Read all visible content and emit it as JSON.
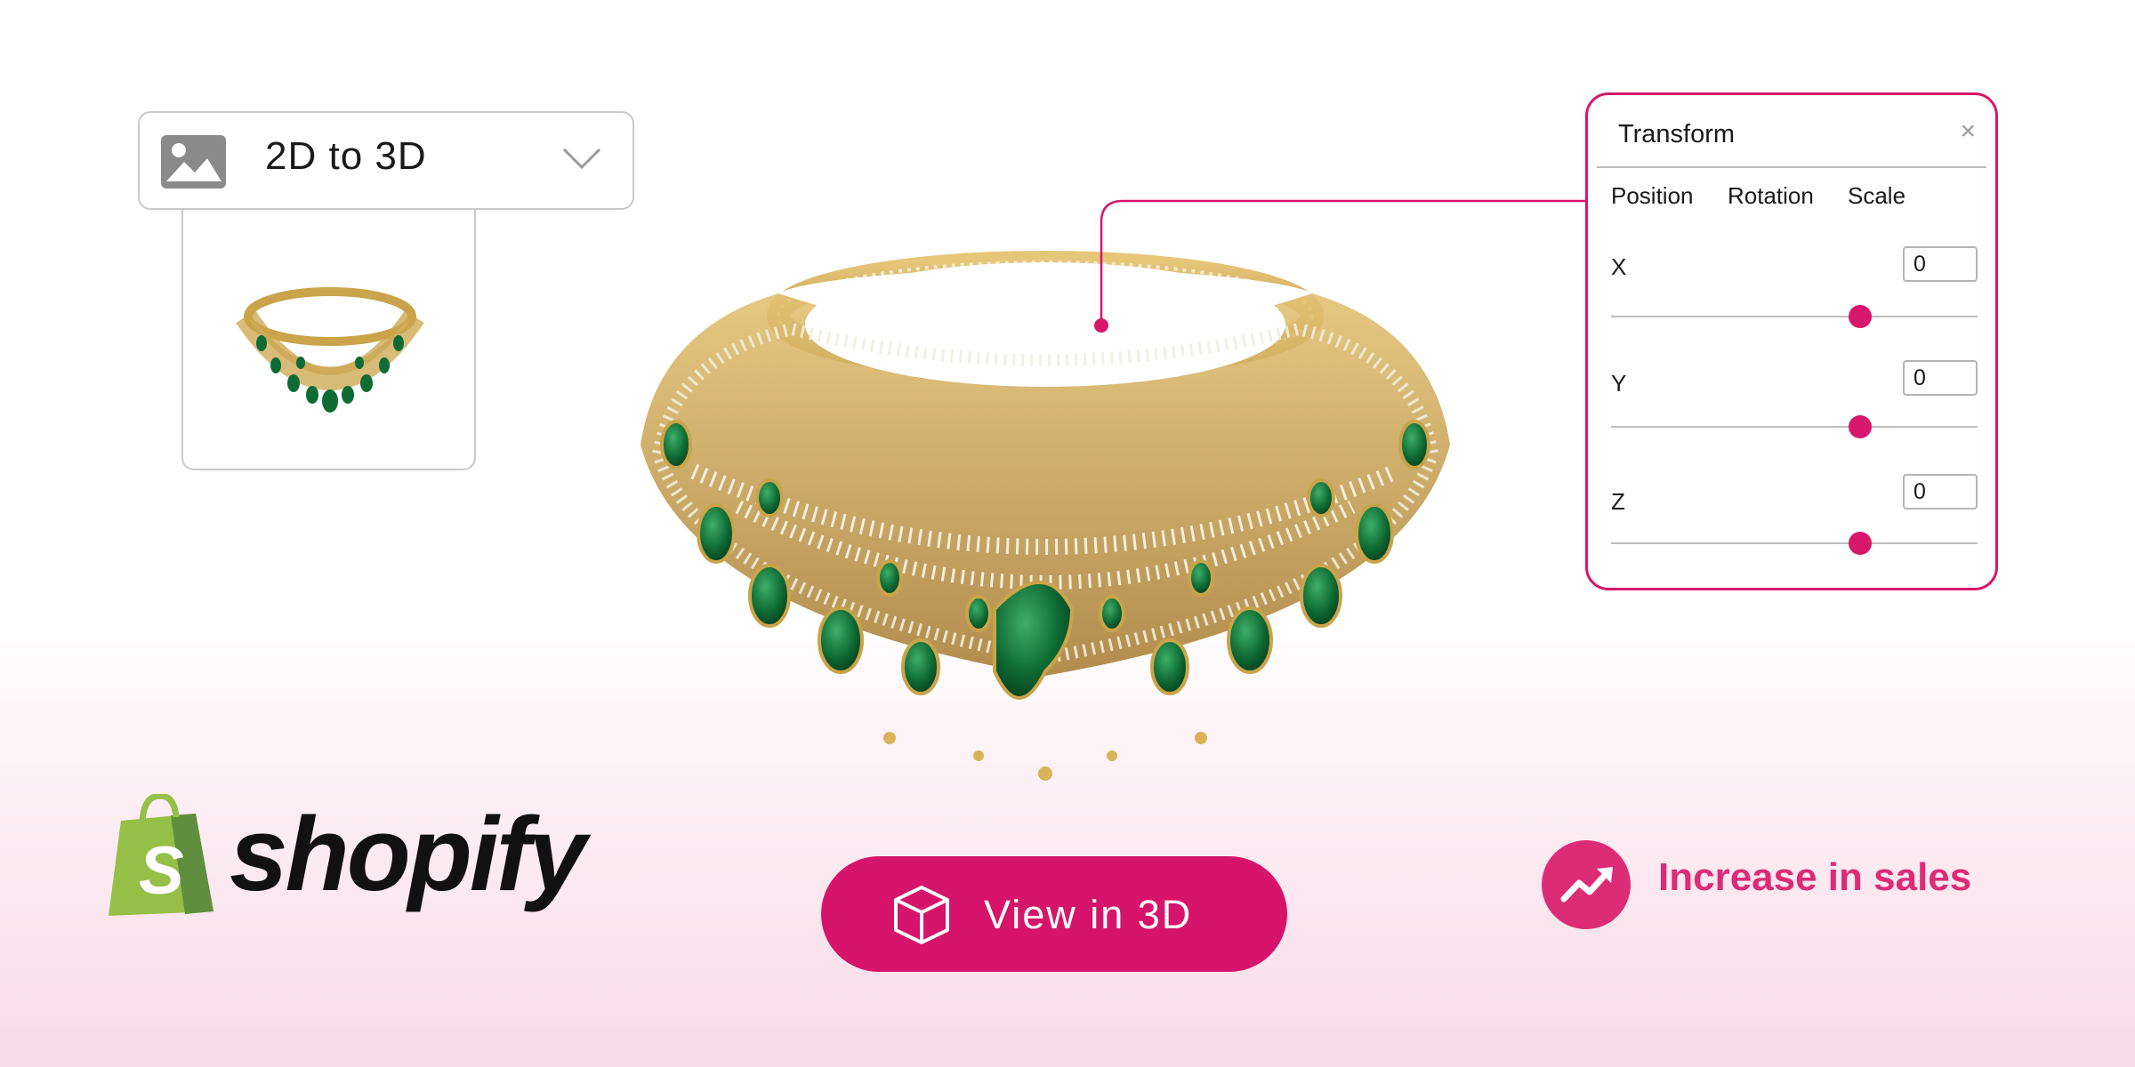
{
  "dropdown": {
    "label": "2D to 3D",
    "icon": "image-icon",
    "chevron": "chevron-down-icon"
  },
  "transform_panel": {
    "title": "Transform",
    "close": "×",
    "tabs": [
      "Position",
      "Rotation",
      "Scale"
    ],
    "axes": [
      {
        "label": "X",
        "value": "0",
        "slider_level": 0.68
      },
      {
        "label": "Y",
        "value": "0",
        "slider_level": 0.68
      },
      {
        "label": "Z",
        "value": "0",
        "slider_level": 0.68
      }
    ]
  },
  "logo": {
    "brand": "shopify"
  },
  "cta": {
    "label": "View in 3D",
    "icon": "cube-icon"
  },
  "sales": {
    "label": "Increase in sales",
    "icon": "trending-up-icon"
  },
  "colors": {
    "accent": "#d7146b",
    "sales": "#dc2c76",
    "shopify_green": "#95bf47",
    "gold": "#c9a44a",
    "emerald": "#0f6b34"
  }
}
